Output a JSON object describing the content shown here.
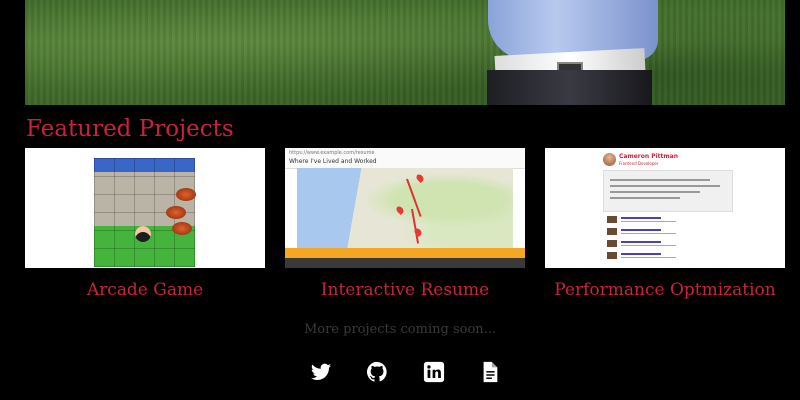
{
  "section_title": "Featured Projects",
  "projects": [
    {
      "title": "Arcade Game"
    },
    {
      "title": "Interactive Resume"
    },
    {
      "title": "Performance Optmization"
    }
  ],
  "map_thumb": {
    "header_small": "https://www.example.com/resume",
    "header_title": "Where I've Lived and Worked"
  },
  "profile_thumb": {
    "name": "Cameron Pittman",
    "subtitle": "Frontend Developer"
  },
  "more_projects": "More projects coming soon...",
  "social_icons": [
    "twitter-icon",
    "github-icon",
    "linkedin-icon",
    "document-icon"
  ],
  "colors": {
    "accent": "#c8233a",
    "background": "#000000",
    "muted_text": "#3a3a3a",
    "icon": "#ffffff"
  }
}
